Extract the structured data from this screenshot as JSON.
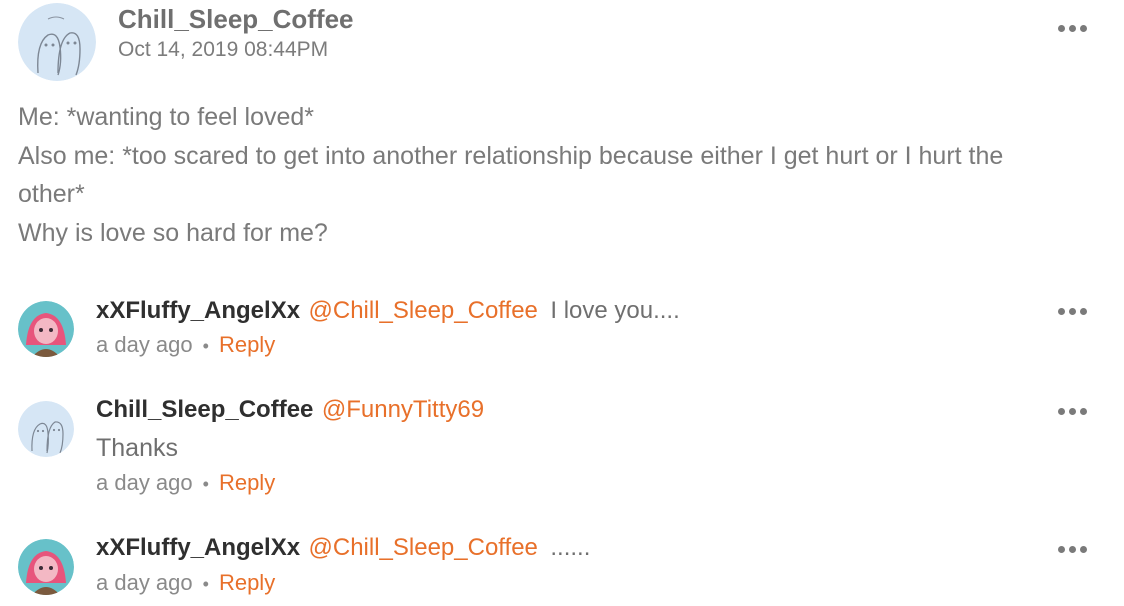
{
  "post": {
    "author": "Chill_Sleep_Coffee",
    "date": "Oct 14, 2019 08:44PM",
    "lines": [
      "Me: *wanting to feel loved*",
      "Also me: *too scared to get into another relationship because either I get hurt or I hurt the",
      "other*",
      "Why is love so hard for me?"
    ],
    "avatar_icon": "ghost-doodle-avatar",
    "more_icon": "more-horizontal-icon"
  },
  "comments": [
    {
      "author": "xXFluffy_AngelXx",
      "mention": "@Chill_Sleep_Coffee",
      "text": "I love you....",
      "time": "a day ago",
      "separator": "•",
      "reply": "Reply",
      "avatar_icon": "anime-pink-avatar"
    },
    {
      "author": "Chill_Sleep_Coffee",
      "mention": "@FunnyTitty69",
      "text": "Thanks",
      "time": "a day ago",
      "separator": "•",
      "reply": "Reply",
      "avatar_icon": "ghost-doodle-avatar"
    },
    {
      "author": "xXFluffy_AngelXx",
      "mention": "@Chill_Sleep_Coffee",
      "text": "......",
      "time": "a day ago",
      "separator": "•",
      "reply": "Reply",
      "avatar_icon": "anime-pink-avatar"
    }
  ],
  "colors": {
    "accent": "#e8702a",
    "text": "#757575",
    "name": "#2f2f2f"
  }
}
